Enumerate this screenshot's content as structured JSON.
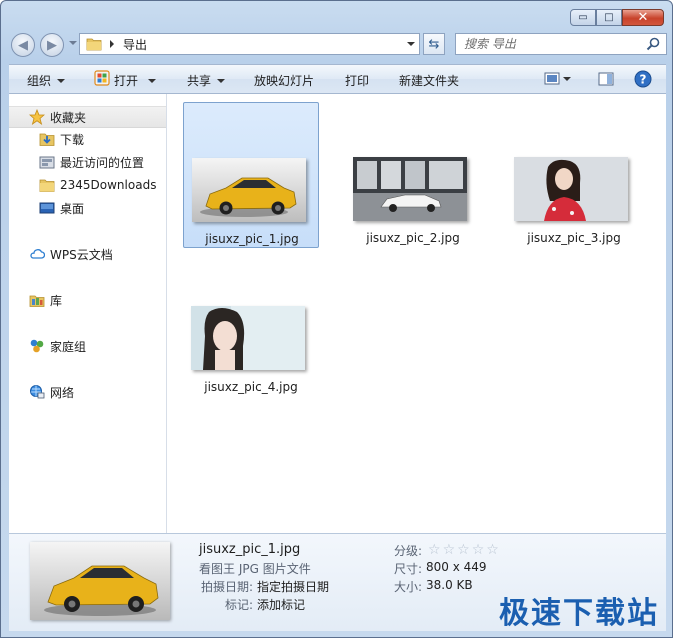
{
  "window": {
    "minimize_glyph": "▭",
    "maximize_glyph": "□",
    "close_glyph": "✕"
  },
  "address_bar": {
    "current_folder": "导出",
    "search_placeholder": "搜索 导出"
  },
  "toolbar": {
    "organize": "组织",
    "open": "打开",
    "share": "共享",
    "slideshow": "放映幻灯片",
    "print": "打印",
    "new_folder": "新建文件夹"
  },
  "nav_pane": {
    "favorites": "收藏夹",
    "downloads": "下载",
    "recent": "最近访问的位置",
    "downloads2345": "2345Downloads",
    "desktop": "桌面",
    "wps": "WPS云文档",
    "libraries": "库",
    "homegroup": "家庭组",
    "network": "网络"
  },
  "files": [
    {
      "name": "jisuxz_pic_1.jpg"
    },
    {
      "name": "jisuxz_pic_2.jpg"
    },
    {
      "name": "jisuxz_pic_3.jpg"
    },
    {
      "name": "jisuxz_pic_4.jpg"
    }
  ],
  "details": {
    "filename": "jisuxz_pic_1.jpg",
    "type": "看图王 JPG 图片文件",
    "date_taken_label": "拍摄日期:",
    "date_taken_value": "指定拍摄日期",
    "tags_label": "标记:",
    "tags_value": "添加标记",
    "rating_label": "分级:",
    "rating_value": 0,
    "dimensions_label": "尺寸:",
    "dimensions_value": "800 x 449",
    "size_label": "大小:",
    "size_value": "38.0 KB"
  },
  "watermark": "极速下载站",
  "colors": {
    "accent": "#1b5fb0",
    "selection": "#c7def9",
    "car_yellow": "#e8b21a"
  }
}
